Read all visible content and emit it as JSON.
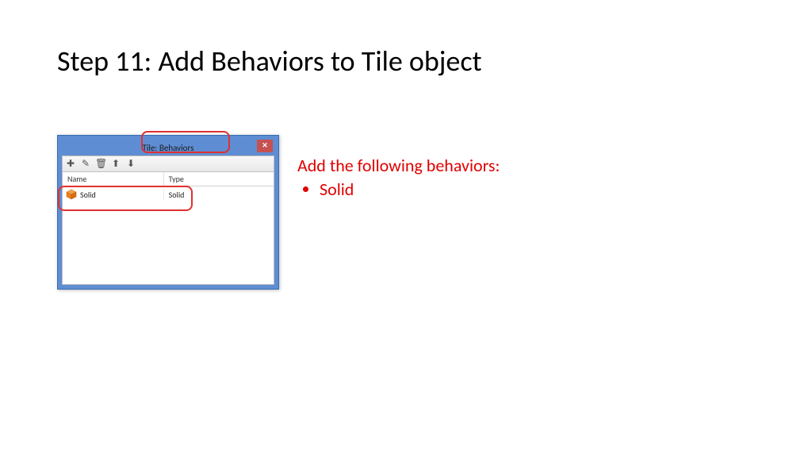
{
  "slide": {
    "title": "Step 11: Add Behaviors to Tile object"
  },
  "dialog": {
    "title": "Tile: Behaviors",
    "close": "✕",
    "toolbar": {
      "add": "✚",
      "edit": "✎",
      "delete": "🗑",
      "up": "⬆",
      "down": "⬇"
    },
    "headers": {
      "name": "Name",
      "type": "Type"
    },
    "rows": [
      {
        "icon": "solid-cube",
        "name": "Solid",
        "type": "Solid"
      }
    ]
  },
  "instructions": {
    "heading": "Add the following behaviors:",
    "items": [
      "Solid"
    ]
  }
}
